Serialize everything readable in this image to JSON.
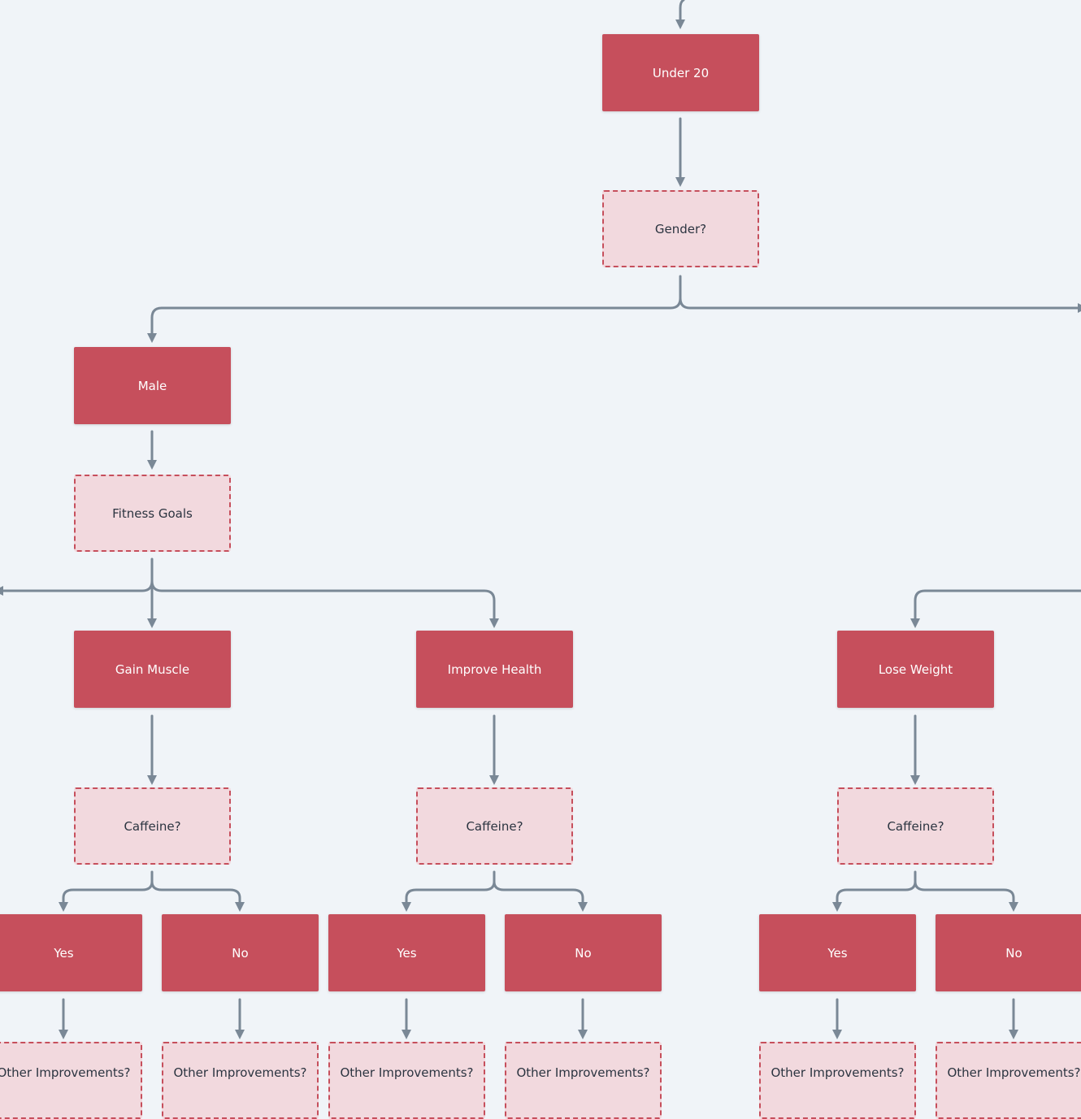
{
  "colors": {
    "decision_fill": "#c64f5c",
    "question_fill": "#f2d9de",
    "question_border": "#c64f5c",
    "connector": "#7a8896",
    "background": "#f0f4f8"
  },
  "nodes": {
    "under20": "Under 20",
    "gender": "Gender?",
    "male": "Male",
    "fitness": "Fitness Goals",
    "gain": "Gain Muscle",
    "improve": "Improve Health",
    "lose": "Lose Weight",
    "caffeine": "Caffeine?",
    "yes": "Yes",
    "no": "No",
    "other": "Other Improvements?"
  }
}
